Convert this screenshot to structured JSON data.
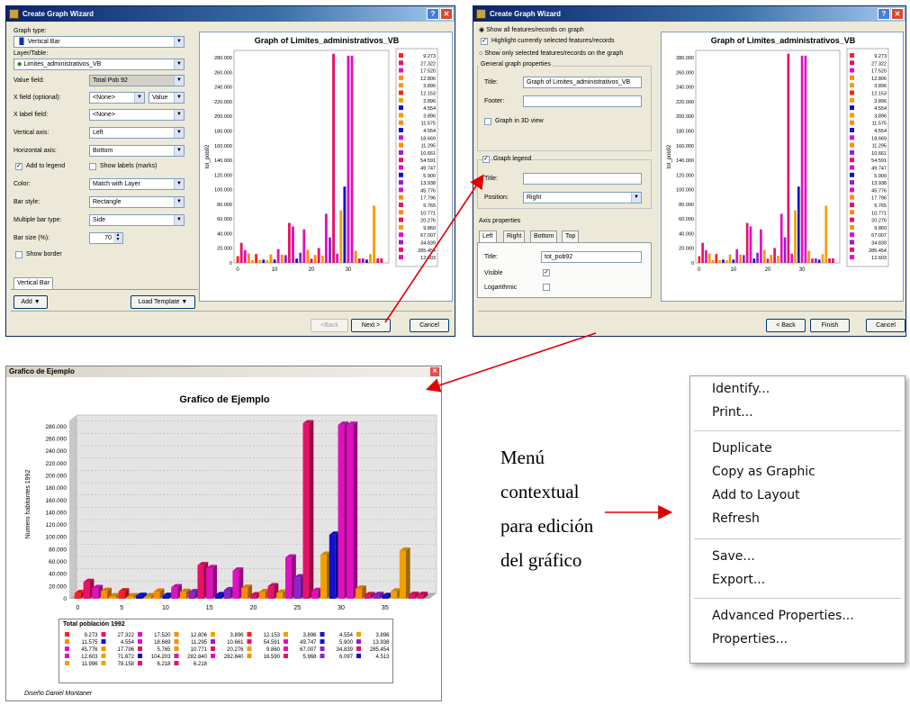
{
  "wizard1": {
    "title": "Create Graph Wizard",
    "graph_type_label": "Graph type:",
    "graph_type_value": "Vertical Bar",
    "layer_label": "Layer/Table:",
    "layer_value": "Limites_administrativos_VB",
    "value_field_label": "Value field:",
    "value_field_value": "Total Pob 92",
    "xfield_label": "X field (optional):",
    "xfield_value": "<None>",
    "xfield_value2": "Value",
    "xlabel_label": "X label field:",
    "xlabel_value": "<None>",
    "vaxis_label": "Vertical axis:",
    "vaxis_value": "Left",
    "haxis_label": "Horizontal axis:",
    "haxis_value": "Bottom",
    "add_legend_label": "Add to legend",
    "show_labels_label": "Show labels (marks)",
    "color_label": "Color:",
    "color_value": "Match with Layer",
    "barstyle_label": "Bar style:",
    "barstyle_value": "Rectangle",
    "multibar_label": "Multiple bar type:",
    "multibar_value": "Side",
    "barsize_label": "Bar size (%):",
    "barsize_value": "70",
    "show_border_label": "Show border",
    "series_tab": "Vertical Bar",
    "add_button": "Add",
    "load_template_button": "Load Template",
    "back_button": "<Back",
    "next_button": "Next >",
    "cancel_button": "Cancel",
    "chart_title": "Graph of Limites_administrativos_VB",
    "ylabel": "tot_pob92"
  },
  "wizard2": {
    "title": "Create Graph Wizard",
    "opt_all": "Show all features/records on graph",
    "opt_highlight": "Highlight currently selected features/records",
    "opt_selected": "Show only selected features/records on the graph",
    "general_group": "General graph properties",
    "title_label": "Title:",
    "title_value": "Graph of Limites_administrativos_VB",
    "footer_label": "Footer:",
    "graph3d_label": "Graph in 3D view",
    "legend_label": "Graph legend",
    "legend_title_label": "Title:",
    "position_label": "Position:",
    "position_value": "Right",
    "axis_group": "Axis properties",
    "tabs": [
      "Left",
      "Right",
      "Bottom",
      "Top"
    ],
    "axis_title_label": "Title:",
    "axis_title_value": "tot_pob92",
    "visible_label": "Visible",
    "log_label": "Logarithmic",
    "back_button": "< Back",
    "finish_button": "Finish",
    "cancel_button": "Cancel",
    "chart_title": "Graph of Limites_administrativos_VB",
    "ylabel": "tot_pob92"
  },
  "result": {
    "title": "Grafico de Ejemplo",
    "chart_title": "Grafico de Ejemplo",
    "ylabel": "Numero habitantes 1992",
    "legend_title": "Total población 1992",
    "footer": "Diseño Daniel Montaner"
  },
  "annotation": {
    "line1": "Menú",
    "line2": "contextual",
    "line3": "para edición",
    "line4": "del gráfico"
  },
  "context_menu": {
    "group1": [
      "Identify...",
      "Print..."
    ],
    "group2": [
      "Duplicate",
      "Copy as Graphic",
      "Add to Layout",
      "Refresh"
    ],
    "group3": [
      "Save...",
      "Export..."
    ],
    "group4": [
      "Advanced Properties...",
      "Properties..."
    ]
  },
  "chart_data": {
    "type": "bar",
    "ylim": [
      0,
      290000
    ],
    "yticks": [
      "0",
      "20.000",
      "40.000",
      "60.000",
      "80.000",
      "100.000",
      "120.000",
      "140.000",
      "160.000",
      "180.000",
      "200.000",
      "220.000",
      "240.000",
      "260.000",
      "280.000"
    ],
    "xticks": [
      "0",
      "10",
      "20",
      "30"
    ],
    "xticks_result": [
      "0",
      "5",
      "10",
      "15",
      "20",
      "25",
      "30",
      "35"
    ],
    "values": [
      9273,
      27322,
      17520,
      12806,
      3896,
      12153,
      3896,
      4554,
      3896,
      11575,
      4554,
      18669,
      11295,
      10661,
      54591,
      49747,
      5900,
      13938,
      45776,
      17796,
      5765,
      10771,
      20276,
      9860,
      67007,
      34839,
      285454,
      12603,
      71672,
      104203,
      282840,
      282840,
      16590,
      5968,
      6097,
      4513,
      11996,
      78158,
      6218,
      6218
    ],
    "colors": [
      "#ff2020",
      "#e8106a",
      "#e010c0",
      "#ff8c00",
      "#f0a000",
      "#ff2020",
      "#f0a000",
      "#1010d0",
      "#f0a000",
      "#ff8c00",
      "#1010d0",
      "#e010c0",
      "#ff8c00",
      "#9020d0",
      "#e8106a",
      "#e010c0",
      "#1010d0",
      "#9020d0",
      "#e010c0",
      "#ff8c00",
      "#e8106a",
      "#ff8c00",
      "#e8106a",
      "#f0a000",
      "#e010c0",
      "#9020d0",
      "#e8106a",
      "#e010c0",
      "#f0a000",
      "#1010d0",
      "#e010c0",
      "#e010c0",
      "#ff8c00",
      "#e8106a",
      "#9020d0",
      "#1010d0",
      "#f0a000",
      "#f0a000",
      "#e8106a",
      "#e8106a"
    ],
    "legend_labels": [
      "9.273",
      "27.322",
      "17.520",
      "12.806",
      "3.896",
      "12.153",
      "3.896",
      "4.554",
      "3.896",
      "11.575",
      "4.554",
      "18.669",
      "11.295",
      "10.661",
      "54.591",
      "49.747",
      "5.900",
      "13.938",
      "45.776",
      "17.796",
      "5.765",
      "10.771",
      "20.276",
      "9.860",
      "67.007",
      "34.839",
      "285.454",
      "12.603",
      "71.672",
      "104.203",
      "282.840",
      "282.840",
      "16.590",
      "5.968",
      "6.097",
      "4.513",
      "11.996",
      "78.158",
      "6.218",
      "6.218"
    ]
  }
}
